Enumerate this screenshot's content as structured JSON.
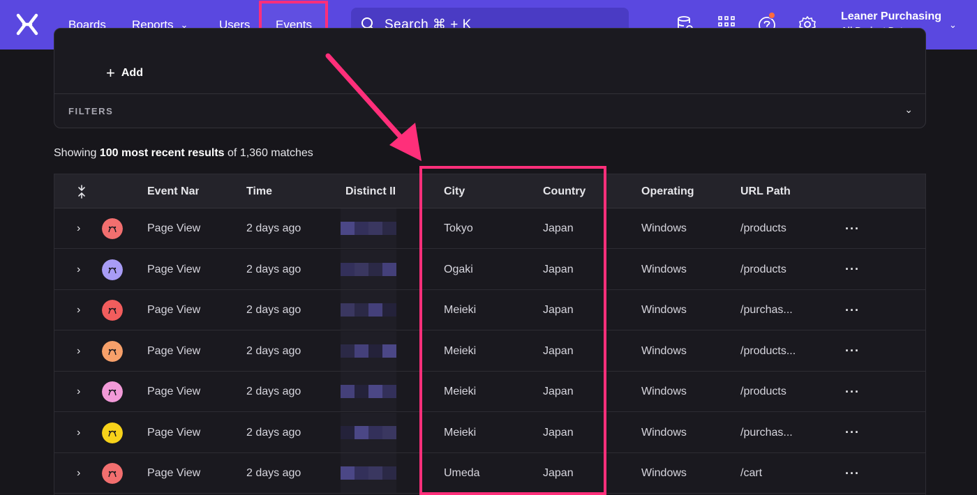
{
  "nav": {
    "items": [
      {
        "label": "Boards"
      },
      {
        "label": "Reports"
      },
      {
        "label": "Users"
      },
      {
        "label": "Events"
      }
    ],
    "search_label": "Search ⌘ + K",
    "project_name": "Leaner Purchasing",
    "project_sub": "All Project Data"
  },
  "filter_card": {
    "add_label": "Add",
    "filters_label": "FILTERS"
  },
  "summary": {
    "prefix": "Showing ",
    "bold": "100 most recent results",
    "suffix": " of 1,360 matches"
  },
  "table": {
    "columns": [
      "Event Nan",
      "Time",
      "Distinct II",
      "City",
      "Country",
      "Operating",
      "URL Path"
    ],
    "rows": [
      {
        "event": "Page View",
        "time": "2 days ago",
        "city": "Tokyo",
        "country": "Japan",
        "os": "Windows",
        "url": "/products",
        "avatar_color": "#f26f6f"
      },
      {
        "event": "Page View",
        "time": "2 days ago",
        "city": "Ogaki",
        "country": "Japan",
        "os": "Windows",
        "url": "/products",
        "avatar_color": "#a89cf5"
      },
      {
        "event": "Page View",
        "time": "2 days ago",
        "city": "Meieki",
        "country": "Japan",
        "os": "Windows",
        "url": "/purchas...",
        "avatar_color": "#f25d5d"
      },
      {
        "event": "Page View",
        "time": "2 days ago",
        "city": "Meieki",
        "country": "Japan",
        "os": "Windows",
        "url": "/products...",
        "avatar_color": "#f7a06a"
      },
      {
        "event": "Page View",
        "time": "2 days ago",
        "city": "Meieki",
        "country": "Japan",
        "os": "Windows",
        "url": "/products",
        "avatar_color": "#f29ad8"
      },
      {
        "event": "Page View",
        "time": "2 days ago",
        "city": "Meieki",
        "country": "Japan",
        "os": "Windows",
        "url": "/purchas...",
        "avatar_color": "#f7d21a"
      },
      {
        "event": "Page View",
        "time": "2 days ago",
        "city": "Umeda",
        "country": "Japan",
        "os": "Windows",
        "url": "/cart",
        "avatar_color": "#f26f6f"
      }
    ]
  },
  "colors": {
    "nav_bg": "#5a48e0",
    "highlight": "#ff2f7a",
    "background": "#17161b"
  }
}
